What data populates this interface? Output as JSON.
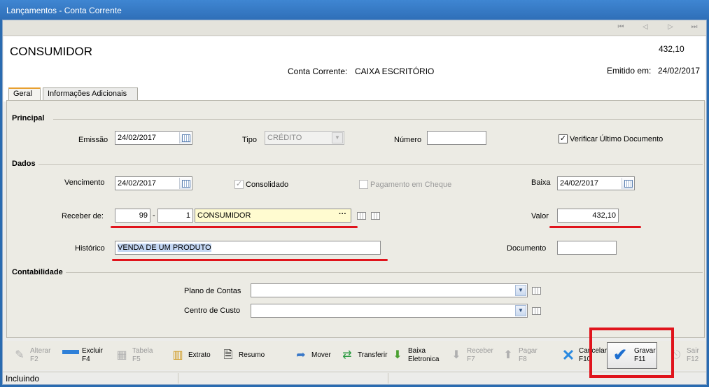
{
  "window": {
    "title": "Lançamentos - Conta Corrente"
  },
  "header": {
    "name": "CONSUMIDOR",
    "amount": "432,10",
    "conta_label": "Conta Corrente:",
    "conta_value": "CAIXA ESCRITÓRIO",
    "emitido_label": "Emitido em:",
    "emitido_value": "24/02/2017"
  },
  "tabs": [
    "Geral",
    "Informações Adicionais"
  ],
  "sections": {
    "principal": "Principal",
    "dados": "Dados",
    "contabilidade": "Contabilidade"
  },
  "principal": {
    "emissao_label": "Emissão",
    "emissao_value": "24/02/2017",
    "tipo_label": "Tipo",
    "tipo_value": "CRÉDITO",
    "numero_label": "Número",
    "numero_value": "",
    "verificar_label": "Verificar Último Documento",
    "verificar_checked": true
  },
  "dados": {
    "vencimento_label": "Vencimento",
    "vencimento_value": "24/02/2017",
    "consolidado_label": "Consolidado",
    "pagamento_cheque_label": "Pagamento em Cheque",
    "baixa_label": "Baixa",
    "baixa_value": "24/02/2017",
    "receber_label": "Receber de:",
    "receber_code": "99",
    "receber_dash": "-",
    "receber_sub": "1",
    "receber_name": "CONSUMIDOR",
    "receber_ellipsis": "···",
    "valor_label": "Valor",
    "valor_value": "432,10",
    "historico_label": "Histórico",
    "historico_value": "VENDA DE UM PRODUTO",
    "documento_label": "Documento",
    "documento_value": ""
  },
  "contabilidade": {
    "plano_label": "Plano de Contas",
    "plano_value": "",
    "centro_label": "Centro de Custo",
    "centro_value": ""
  },
  "toolbar": {
    "alterar": [
      "Alterar",
      "F2"
    ],
    "excluir": [
      "Excluir",
      "F4"
    ],
    "tabela": [
      "Tabela",
      "F5"
    ],
    "extrato": "Extrato",
    "resumo": "Resumo",
    "mover": "Mover",
    "transferir": "Transferir",
    "baixa_eletronica": [
      "Baixa",
      "Eletronica"
    ],
    "receber": [
      "Receber",
      "F7"
    ],
    "pagar": [
      "Pagar",
      "F8"
    ],
    "cancelar": [
      "Cancelar",
      "F10"
    ],
    "gravar": [
      "Gravar",
      "F11"
    ],
    "sair": [
      "Sair",
      "F12"
    ]
  },
  "status": {
    "mode": "Incluindo"
  },
  "colors": {
    "highlight_red": "#e0141c",
    "selection_blue": "#c5d8f5",
    "lookup_yellow": "#fffbd0"
  }
}
